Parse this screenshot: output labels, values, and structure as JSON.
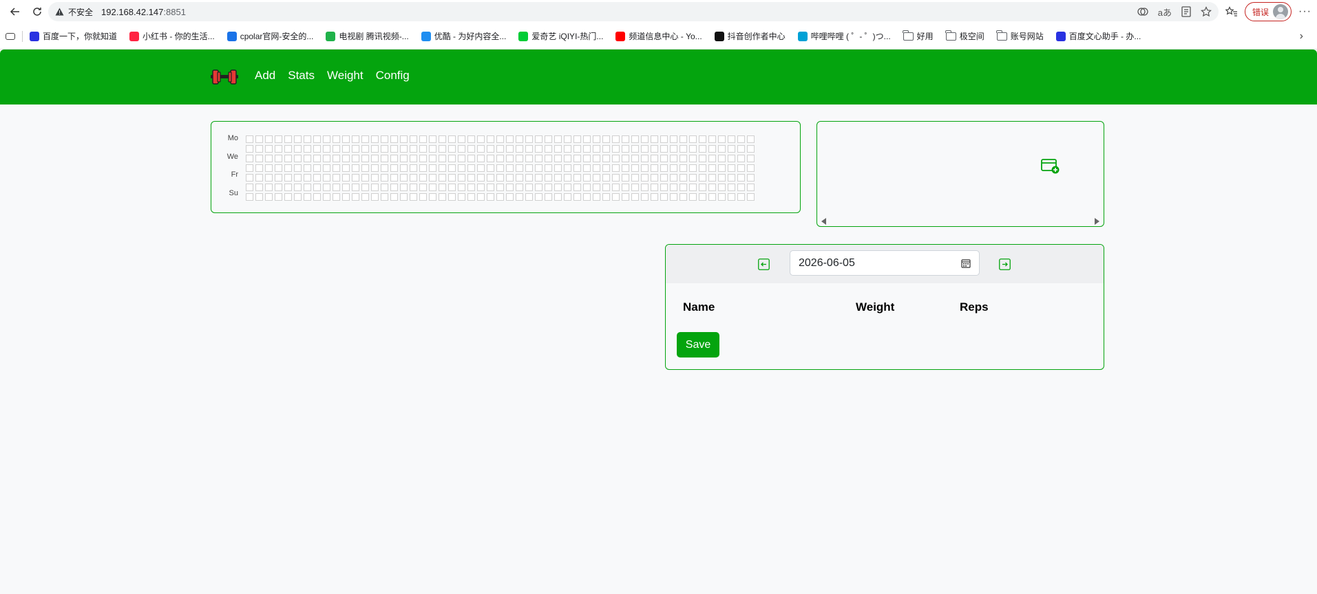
{
  "browser": {
    "insecure_label": "不安全",
    "url_host": "192.168.42.147",
    "url_port": ":8851",
    "error_label": "错误",
    "icons": [
      "back-icon",
      "reload-icon",
      "warning-icon",
      "tracking-icon",
      "translate-icon",
      "reader-icon",
      "favorite-star-icon",
      "favorites-list-icon",
      "profile-icon",
      "more-icon"
    ]
  },
  "bookmarks": [
    {
      "label": "百度一下，你就知道",
      "icon": "baidu-icon",
      "color": "#2932e1"
    },
    {
      "label": "小红书 - 你的生活...",
      "icon": "xiaohongshu-icon",
      "color": "#ff2442"
    },
    {
      "label": "cpolar官网-安全的...",
      "icon": "cpolar-icon",
      "color": "#1a73e8"
    },
    {
      "label": "电视剧 腾讯视频-...",
      "icon": "tencent-video-icon",
      "color": "#20b24a"
    },
    {
      "label": "优酷 - 为好内容全...",
      "icon": "youku-icon",
      "color": "#1f8ef1"
    },
    {
      "label": "爱奇艺 iQIYI-热门...",
      "icon": "iqiyi-icon",
      "color": "#00cc36"
    },
    {
      "label": "频道信息中心 - Yo...",
      "icon": "youtube-icon",
      "color": "#ff0000"
    },
    {
      "label": "抖音创作者中心",
      "icon": "douyin-icon",
      "color": "#111111"
    },
    {
      "label": "哔哩哔哩 ( ゜- ゜)つ...",
      "icon": "bilibili-icon",
      "color": "#00a1d6"
    },
    {
      "label": "好用",
      "icon": "folder-icon",
      "color": ""
    },
    {
      "label": "极空间",
      "icon": "folder-icon",
      "color": ""
    },
    {
      "label": "账号网站",
      "icon": "folder-icon",
      "color": ""
    },
    {
      "label": "百度文心助手 - 办...",
      "icon": "baidu-icon",
      "color": "#2932e1"
    }
  ],
  "app": {
    "brand_icon": "dumbbell-icon",
    "nav": {
      "add": "Add",
      "stats": "Stats",
      "weight": "Weight",
      "config": "Config"
    },
    "accent_color": "#04a40e",
    "heatmap": {
      "day_labels": [
        "Mo",
        "",
        "We",
        "",
        "Fr",
        "",
        "Su"
      ],
      "weeks": 53,
      "days_per_week": 7,
      "filled_cells": 0
    },
    "weight_panel": {
      "add_icon": "add-weight-icon"
    },
    "workout": {
      "date": "2026-06-05",
      "columns": {
        "name": "Name",
        "weight": "Weight",
        "reps": "Reps"
      },
      "save_label": "Save"
    }
  }
}
